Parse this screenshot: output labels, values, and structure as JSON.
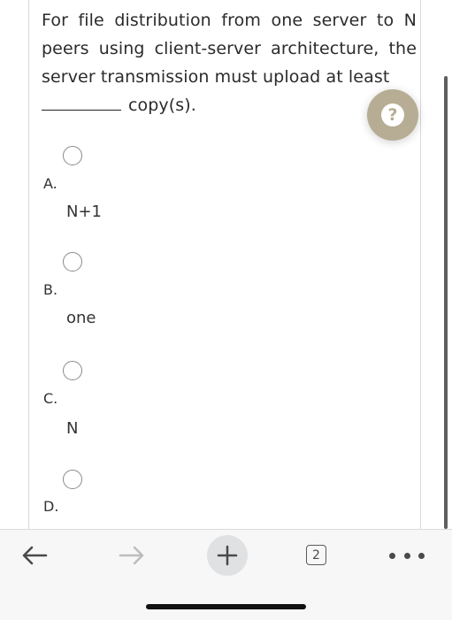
{
  "question": {
    "text_before_blank": "For file distribution from one server to N peers using client-server architecture, the server transmission must upload at least",
    "text_after_blank": "copy(s)."
  },
  "help_button": {
    "icon": "question-icon",
    "glyph": "?"
  },
  "options": [
    {
      "letter": "A.",
      "text": "N+1"
    },
    {
      "letter": "B.",
      "text": "one"
    },
    {
      "letter": "C.",
      "text": "N"
    },
    {
      "letter": "D.",
      "text": ""
    }
  ],
  "toolbar": {
    "back_icon": "back-arrow-icon",
    "forward_icon": "forward-arrow-icon",
    "new_tab_icon": "plus-icon",
    "tab_count": "2",
    "menu_icon": "more-dots-icon"
  },
  "colors": {
    "help_button": "#b7ad94",
    "radio_border": "#8a8a8a",
    "toolbar_bg": "#f7f7f7"
  }
}
